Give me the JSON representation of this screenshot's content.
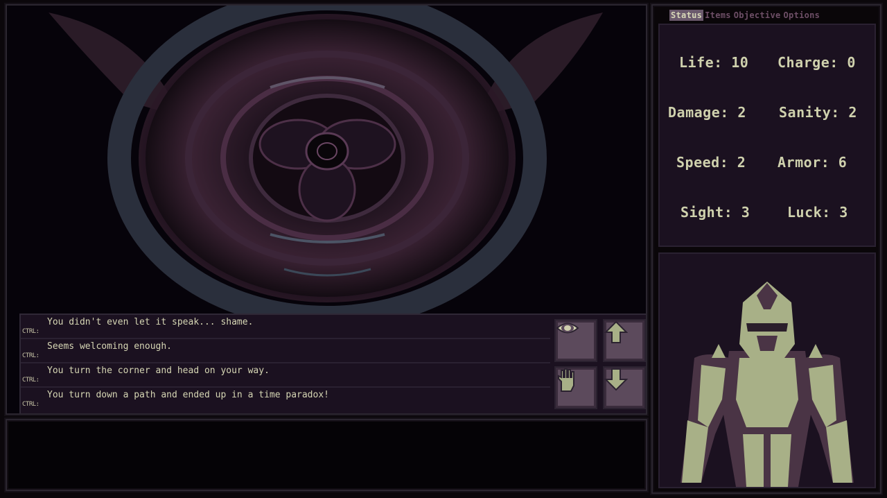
{
  "tabs": [
    "Status",
    "Items",
    "Objective",
    "Options"
  ],
  "stats": {
    "life": "Life: 10",
    "charge": "Charge: 0",
    "damage": "Damage: 2",
    "sanity": "Sanity: 2",
    "speed": "Speed: 2",
    "armor": "Armor: 6",
    "sight": "Sight: 3",
    "luck": "Luck: 3"
  },
  "log": [
    {
      "prefix": "CTRL:",
      "text": "You didn't even let it speak... shame."
    },
    {
      "prefix": "CTRL:",
      "text": "Seems welcoming enough."
    },
    {
      "prefix": "CTRL:",
      "text": "You turn the corner and head on your way."
    },
    {
      "prefix": "CTRL:",
      "text": "You turn down a path and ended up in a time paradox!"
    }
  ],
  "actions": {
    "look_icon": "eye-icon",
    "forward_icon": "arrow-up-icon",
    "interact_icon": "hand-icon",
    "back_icon": "arrow-down-icon"
  },
  "colors": {
    "panel_bg": "#1b1120",
    "text": "#d6d6b4",
    "button": "#5c4a5c",
    "tab_active": "#6b5a6d",
    "tab_inactive": "#6d4e66",
    "portrait": "#a8b087"
  }
}
